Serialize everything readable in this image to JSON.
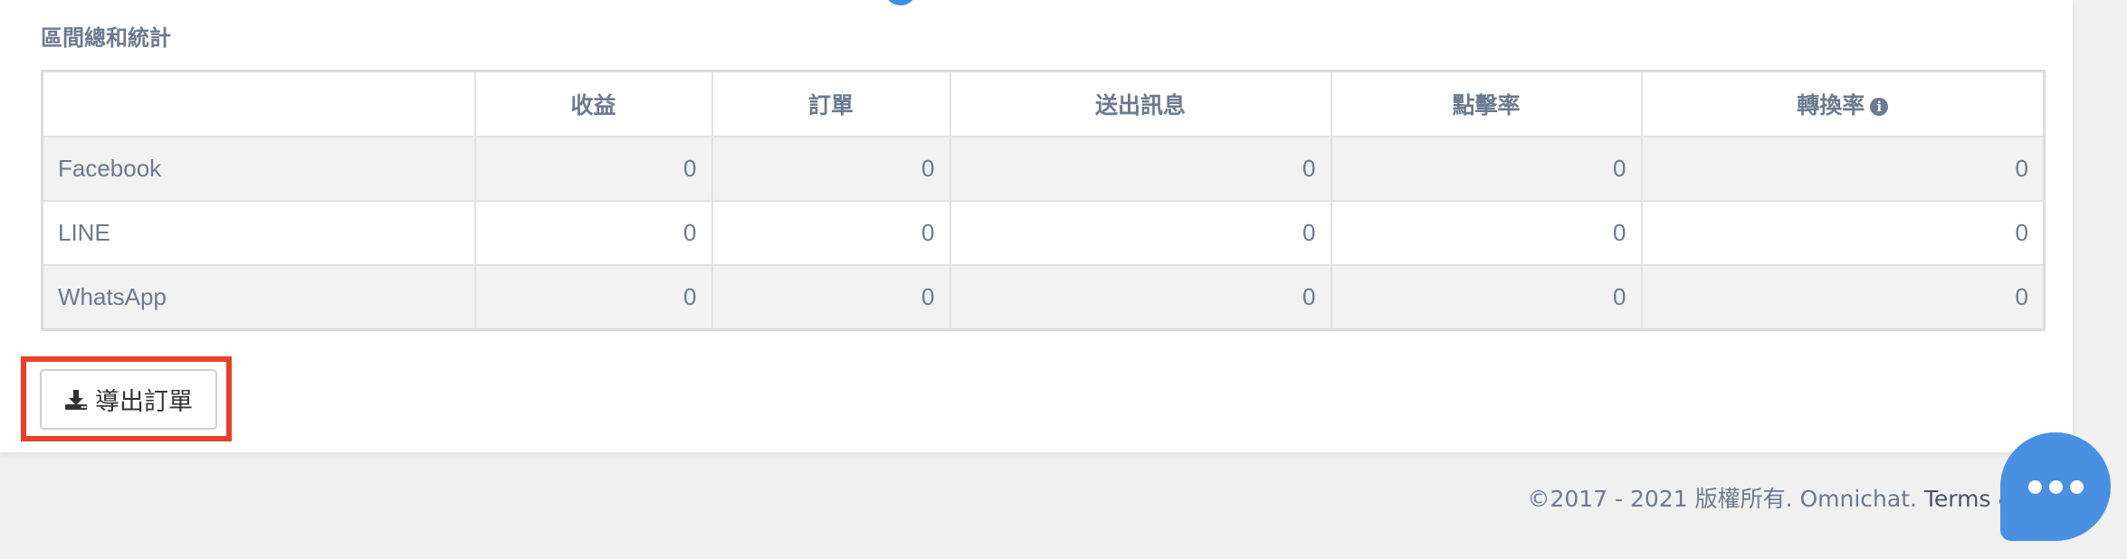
{
  "section": {
    "title": "區間總和統計"
  },
  "table": {
    "headers": [
      "",
      "收益",
      "訂單",
      "送出訊息",
      "點擊率",
      "轉換率"
    ],
    "rows": [
      {
        "name": "Facebook",
        "values": [
          "0",
          "0",
          "0",
          "0",
          "0"
        ]
      },
      {
        "name": "LINE",
        "values": [
          "0",
          "0",
          "0",
          "0",
          "0"
        ]
      },
      {
        "name": "WhatsApp",
        "values": [
          "0",
          "0",
          "0",
          "0",
          "0"
        ]
      }
    ],
    "conversion_info_icon": "info-circle-icon"
  },
  "export": {
    "label": "導出訂單",
    "icon": "download-icon",
    "highlight_color": "#e8402a"
  },
  "footer": {
    "copyright": "©2017 - 2021 版權所有. Omnichat.",
    "terms_link": "Terms & P"
  },
  "chat_widget": {
    "icon": "chat-ellipsis-icon",
    "color": "#4a90e2"
  }
}
